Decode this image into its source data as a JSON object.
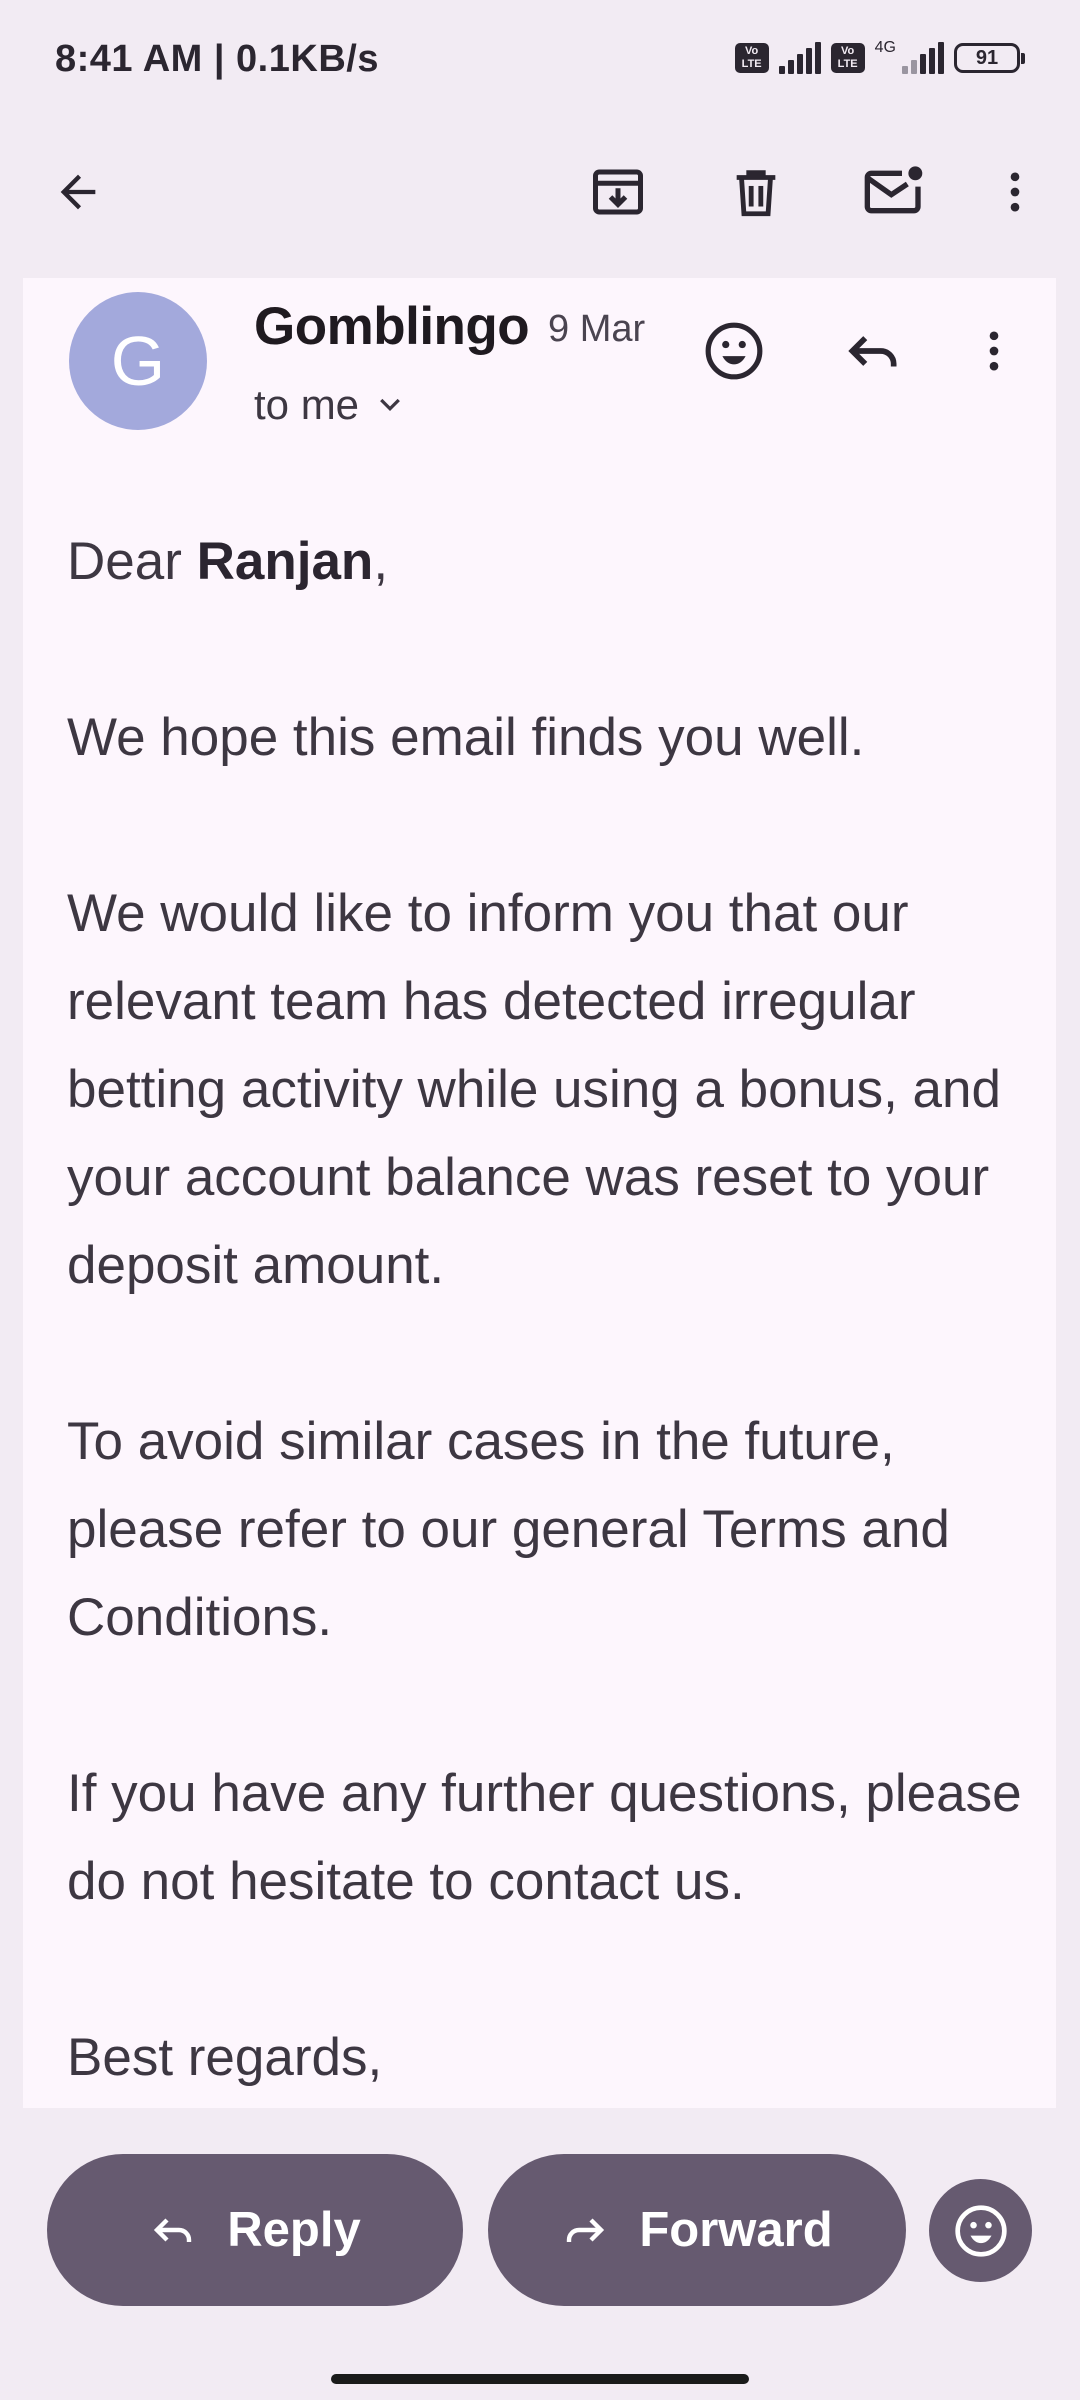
{
  "status_bar": {
    "time_speed": "8:41 AM | 0.1KB/s",
    "network_type": "4G",
    "volte_label": "Vo LTE",
    "battery_level": "91"
  },
  "app_bar": {
    "icons": [
      "back-arrow-icon",
      "archive-icon",
      "delete-icon",
      "mark-unread-icon",
      "more-vert-icon"
    ]
  },
  "message": {
    "avatar_letter": "G",
    "avatar_color": "#a3a9dc",
    "sender": "Gomblingo",
    "date": "9 Mar",
    "recipient": "to me",
    "greeting_prefix": "Dear ",
    "greeting_name": "Ranjan",
    "greeting_suffix": ",",
    "paragraphs": [
      "We hope this email finds you well.",
      "We would like to inform you that our relevant team has detected irregular betting activity while using a bonus, and your account balance was reset to your deposit amount.",
      "To avoid similar cases in the future, please refer to our general Terms and Conditions.",
      "If you have any further questions, please do not hesitate to contact us."
    ],
    "closing": "Best regards,"
  },
  "actions": {
    "reply_label": "Reply",
    "forward_label": "Forward",
    "accent_color": "#665a70"
  }
}
